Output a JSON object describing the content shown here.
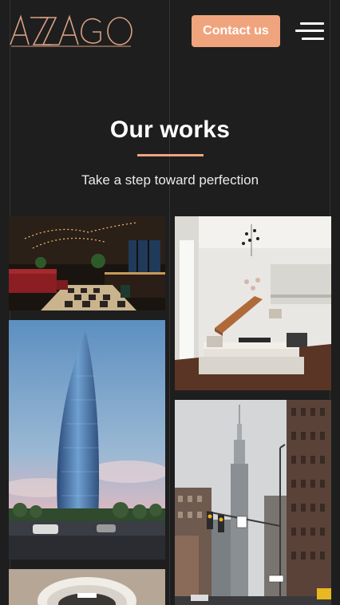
{
  "header": {
    "logo_text": "AZAGO",
    "contact_label": "Contact us",
    "menu_icon": "hamburger-menu-icon"
  },
  "works": {
    "title": "Our works",
    "subtitle": "Take a step toward perfection",
    "items": [
      {
        "name": "restaurant-interior"
      },
      {
        "name": "living-room-interior"
      },
      {
        "name": "glass-skyscraper"
      },
      {
        "name": "city-street"
      },
      {
        "name": "round-interior"
      }
    ]
  },
  "colors": {
    "background": "#1e1e1e",
    "accent": "#f0a47e",
    "text": "#ffffff"
  }
}
